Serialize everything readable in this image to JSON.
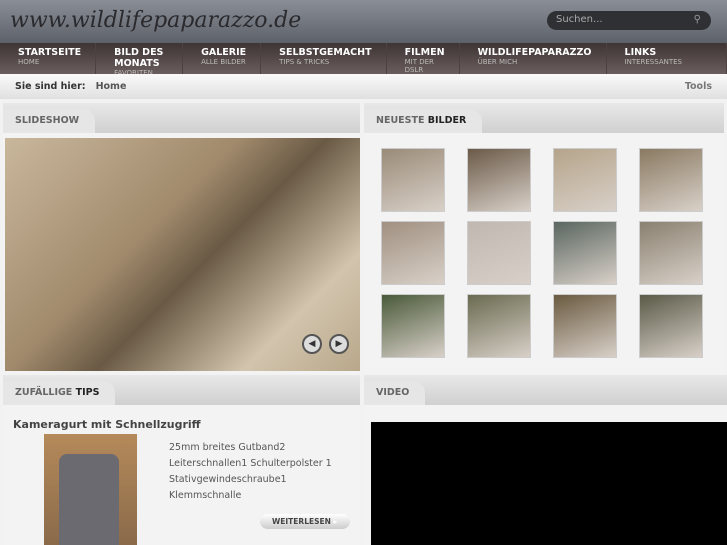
{
  "header": {
    "logo": "www.wildlifepaparazzo.de",
    "search_placeholder": "Suchen...",
    "search_icon": "magnifier-icon"
  },
  "nav": [
    {
      "label": "STARTSEITE",
      "sub": "HOME"
    },
    {
      "label": "BILD DES MONATS",
      "sub": "FAVORITEN"
    },
    {
      "label": "GALERIE",
      "sub": "ALLE BILDER"
    },
    {
      "label": "SELBSTGEMACHT",
      "sub": "TIPS & TRICKS"
    },
    {
      "label": "FILMEN",
      "sub": "MIT DER DSLR"
    },
    {
      "label": "WILDLIFEPAPARAZZO",
      "sub": "ÜBER MICH"
    },
    {
      "label": "LINKS",
      "sub": "INTERESSANTES"
    }
  ],
  "breadcrumb": {
    "label": "Sie sind hier:",
    "home": "Home",
    "tools": "Tools"
  },
  "slideshow": {
    "title": "SLIDESHOW",
    "prev": "◀",
    "next": "▶"
  },
  "latest": {
    "title_a": "NEUESTE ",
    "title_b": "BILDER"
  },
  "tips": {
    "title_a": "ZUFÄLLIGE ",
    "title_b": "TIPS",
    "heading": "Kameragurt mit Schnellzugriff",
    "lines": [
      "25mm breites Gutband2",
      "Leiterschnallen1 Schulterpolster 1",
      "Stativgewindeschraube1",
      "Klemmschnalle"
    ],
    "more": "WEITERLESEN"
  },
  "video": {
    "title": "VIDEO"
  }
}
